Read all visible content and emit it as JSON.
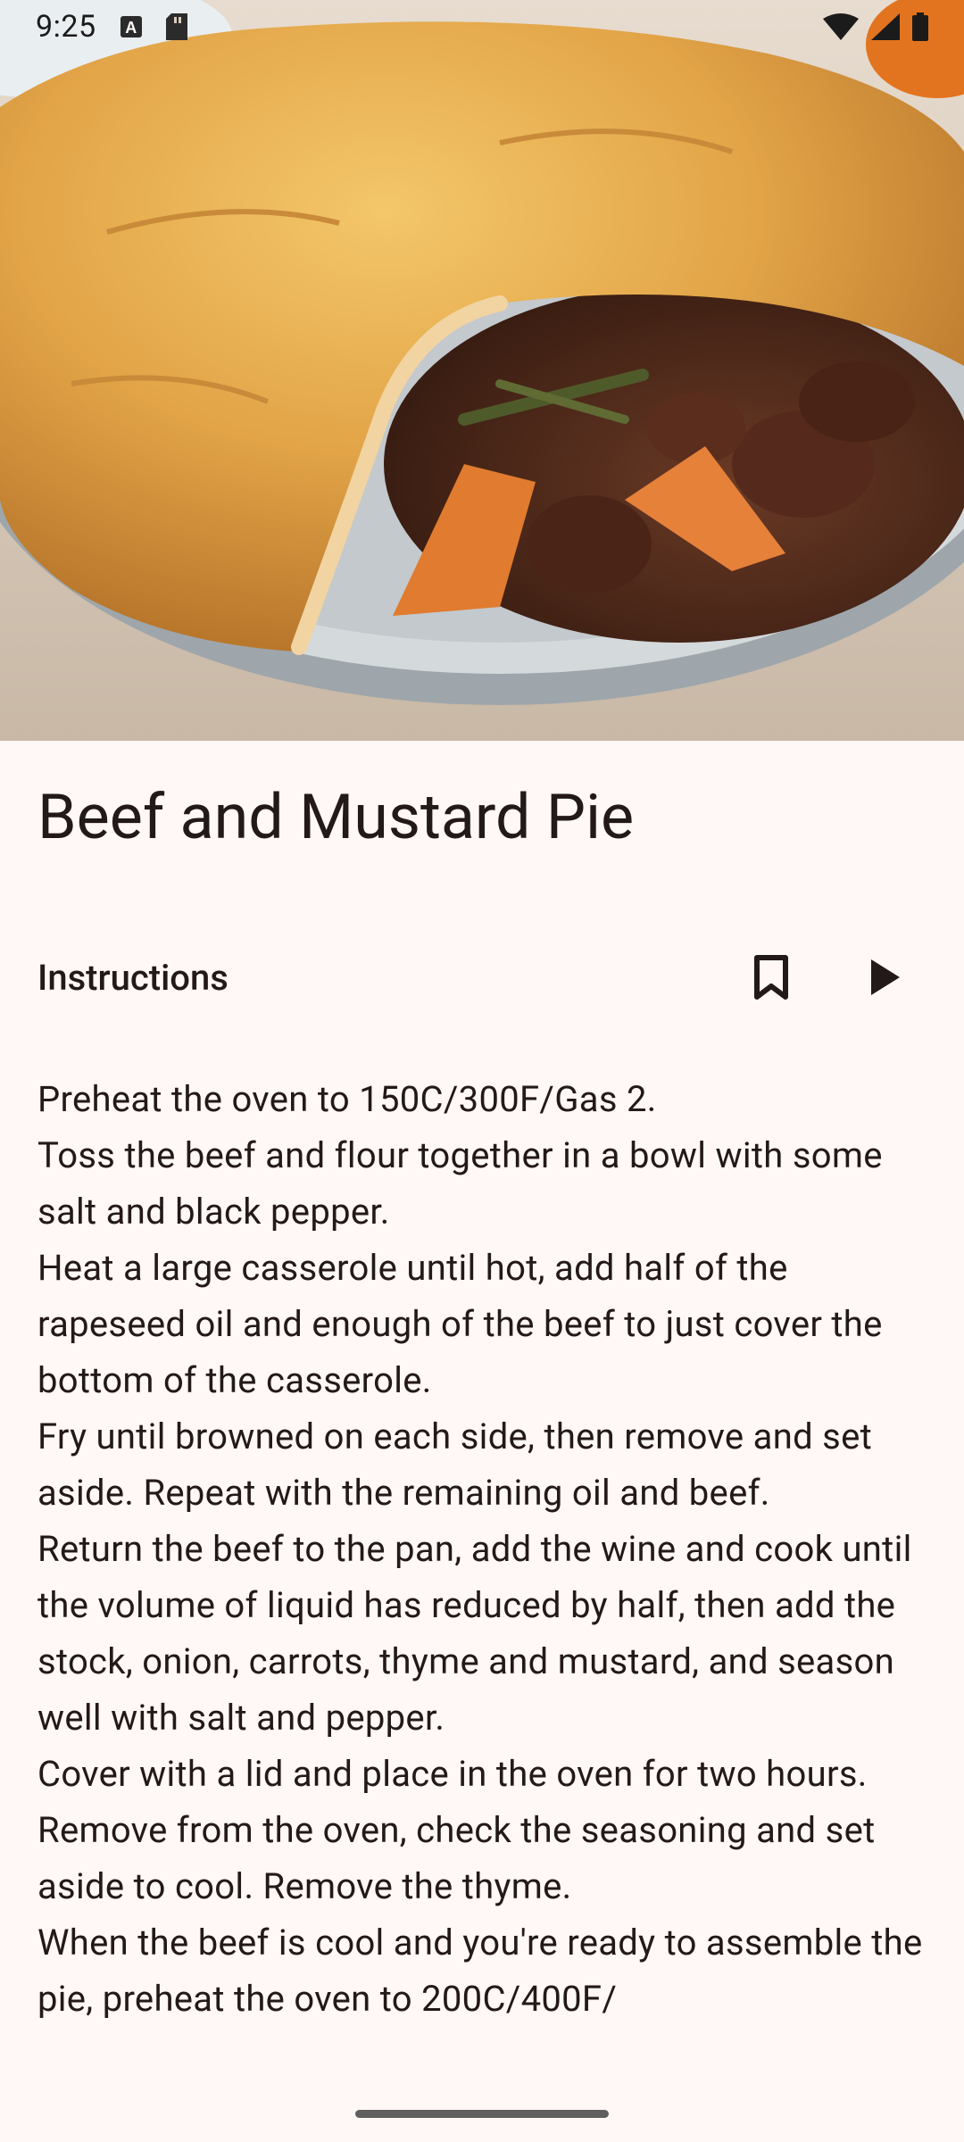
{
  "status_bar": {
    "time": "9:25",
    "icons": [
      "a-badge-icon",
      "sd-card-icon",
      "wifi-icon",
      "signal-icon",
      "battery-icon"
    ]
  },
  "hero": {
    "image_subject": "beef-and-mustard-pie-photo"
  },
  "recipe": {
    "title": "Beef and Mustard Pie",
    "section_label": "Instructions",
    "actions": {
      "bookmark_icon": "bookmark-icon",
      "play_icon": "play-icon"
    },
    "steps": [
      "Preheat the oven to 150C/300F/Gas 2.",
      "Toss the beef and flour together in a bowl with some salt and black pepper.",
      "Heat a large casserole until hot, add half of the rapeseed oil and enough of the beef to just cover the bottom of the casserole.",
      "Fry until browned on each side, then remove and set aside. Repeat with the remaining oil and beef.",
      "Return the beef to the pan, add the wine and cook until the volume of liquid has reduced by half, then add the stock, onion, carrots, thyme and mustard, and season well with salt and pepper.",
      "Cover with a lid and place in the oven for two hours.",
      "Remove from the oven, check the seasoning and set aside to cool. Remove the thyme.",
      "When the beef is cool and you're ready to assemble the pie, preheat the oven to 200C/400F/"
    ]
  },
  "colors": {
    "background": "#fff8f6",
    "text": "#231918",
    "crust": "#e0a94a",
    "dish": "#cfd3d6"
  }
}
